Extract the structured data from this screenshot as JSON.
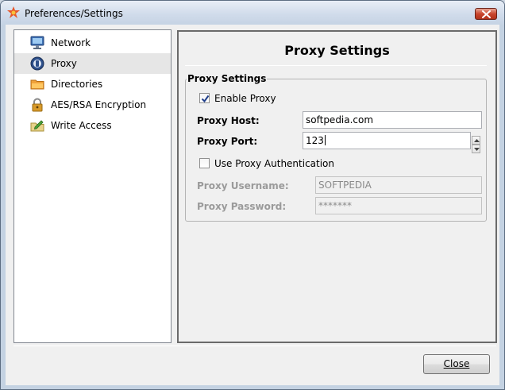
{
  "window": {
    "title": "Preferences/Settings"
  },
  "sidebar": {
    "items": [
      {
        "label": "Network",
        "icon": "monitor-icon",
        "selected": false
      },
      {
        "label": "Proxy",
        "icon": "proxy-globe-icon",
        "selected": true
      },
      {
        "label": "Directories",
        "icon": "folder-icon",
        "selected": false
      },
      {
        "label": "AES/RSA Encryption",
        "icon": "padlock-icon",
        "selected": false
      },
      {
        "label": "Write Access",
        "icon": "write-folder-icon",
        "selected": false
      }
    ]
  },
  "panel": {
    "title": "Proxy Settings",
    "group_label": "Proxy Settings",
    "enable_proxy": {
      "label": "Enable Proxy",
      "checked": true
    },
    "proxy_host": {
      "label": "Proxy Host:",
      "value": "softpedia.com"
    },
    "proxy_port": {
      "label": "Proxy Port:",
      "value": "123"
    },
    "use_auth": {
      "label": "Use Proxy Authentication",
      "checked": false
    },
    "proxy_username": {
      "label": "Proxy Username:",
      "value": "SOFTPEDIA",
      "disabled": true
    },
    "proxy_password": {
      "label": "Proxy Password:",
      "value": "*******",
      "disabled": true
    }
  },
  "footer": {
    "close_label": "Close"
  },
  "colors": {
    "selection": "#e6e6e6",
    "close_red": "#c9452d",
    "titlebar": "#d1dceb"
  }
}
